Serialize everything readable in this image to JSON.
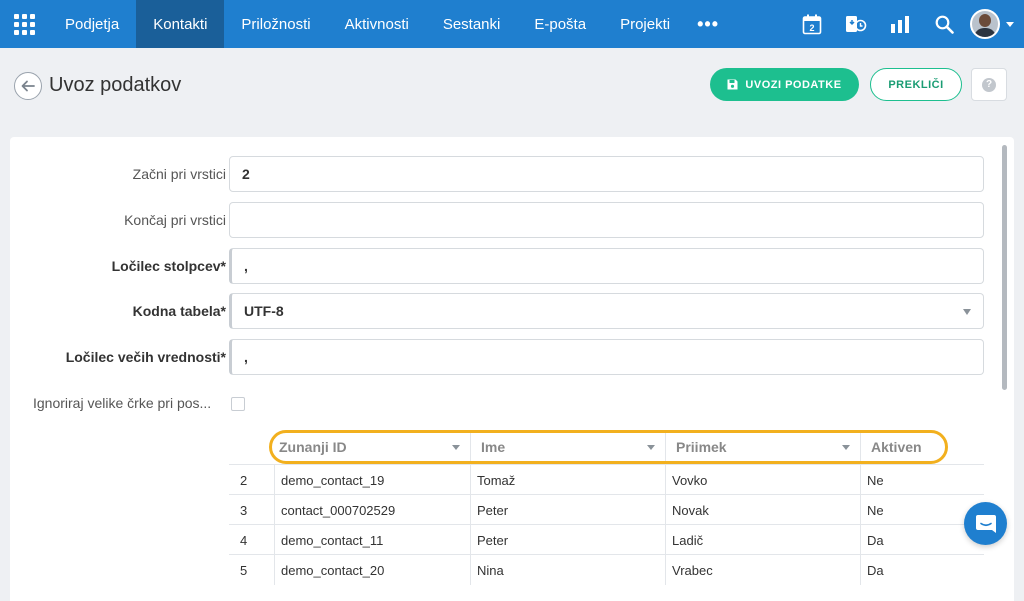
{
  "nav": {
    "items": [
      {
        "label": "Podjetja",
        "active": false
      },
      {
        "label": "Kontakti",
        "active": true
      },
      {
        "label": "Priložnosti",
        "active": false
      },
      {
        "label": "Aktivnosti",
        "active": false
      },
      {
        "label": "Sestanki",
        "active": false
      },
      {
        "label": "E-pošta",
        "active": false
      },
      {
        "label": "Projekti",
        "active": false
      }
    ],
    "more_label": "•••",
    "calendar_day": "2",
    "icons": [
      "apps-grid-icon",
      "calendar-icon",
      "sync-icon",
      "bar-chart-icon",
      "search-icon",
      "avatar"
    ]
  },
  "header": {
    "title": "Uvoz podatkov",
    "import_label": "UVOZI PODATKE",
    "cancel_label": "PREKLIČI",
    "help_label": "?"
  },
  "form": {
    "start_row": {
      "label": "Začni pri vrstici",
      "value": "2"
    },
    "end_row": {
      "label": "Končaj pri vrstici",
      "value": ""
    },
    "column_separator": {
      "label": "Ločilec stolpcev*",
      "value": ","
    },
    "encoding": {
      "label": "Kodna tabela*",
      "value": "UTF-8"
    },
    "multi_value_separator": {
      "label": "Ločilec večih vrednosti*",
      "value": ","
    },
    "ignore_case": {
      "label": "Ignoriraj velike črke pri pos...",
      "checked": false
    }
  },
  "table": {
    "columns": [
      "Zunanji ID",
      "Ime",
      "Priimek",
      "Aktiven"
    ],
    "rows": [
      {
        "n": "2",
        "id": "demo_contact_19",
        "ime": "Tomaž",
        "priimek": "Vovko",
        "aktiven": "Ne"
      },
      {
        "n": "3",
        "id": "contact_000702529",
        "ime": "Peter",
        "priimek": "Novak",
        "aktiven": "Ne"
      },
      {
        "n": "4",
        "id": "demo_contact_11",
        "ime": "Peter",
        "priimek": "Ladič",
        "aktiven": "Da"
      },
      {
        "n": "5",
        "id": "demo_contact_20",
        "ime": "Nina",
        "priimek": "Vrabec",
        "aktiven": "Da"
      }
    ]
  },
  "colors": {
    "nav_bg": "#1f7fcf",
    "nav_active_bg": "#1a5f99",
    "primary_green": "#1dbf8f",
    "highlight_orange": "#f2b01e"
  }
}
